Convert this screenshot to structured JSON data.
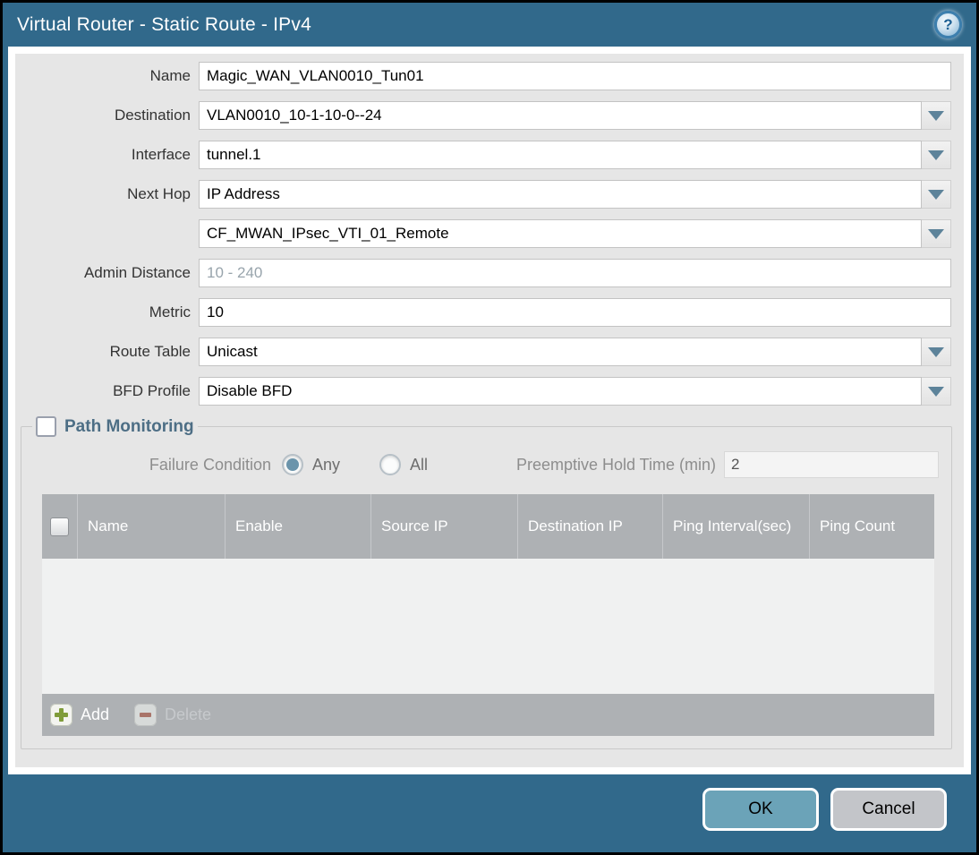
{
  "dialog": {
    "title": "Virtual Router - Static Route - IPv4",
    "help_glyph": "?"
  },
  "form": {
    "name": {
      "label": "Name",
      "value": "Magic_WAN_VLAN0010_Tun01"
    },
    "destination": {
      "label": "Destination",
      "value": "VLAN0010_10-1-10-0--24"
    },
    "interface": {
      "label": "Interface",
      "value": "tunnel.1"
    },
    "next_hop": {
      "label": "Next Hop",
      "value": "IP Address"
    },
    "next_hop_address": {
      "value": "CF_MWAN_IPsec_VTI_01_Remote"
    },
    "admin_distance": {
      "label": "Admin Distance",
      "placeholder": "10 - 240",
      "value": ""
    },
    "metric": {
      "label": "Metric",
      "value": "10"
    },
    "route_table": {
      "label": "Route Table",
      "value": "Unicast"
    },
    "bfd_profile": {
      "label": "BFD Profile",
      "value": "Disable BFD"
    }
  },
  "path_monitoring": {
    "title": "Path Monitoring",
    "enabled": false,
    "failure_condition_label": "Failure Condition",
    "options": [
      {
        "label": "Any",
        "selected": true
      },
      {
        "label": "All",
        "selected": false
      }
    ],
    "preemptive_hold_time_label": "Preemptive Hold Time (min)",
    "preemptive_hold_time_value": "2",
    "table": {
      "columns": [
        "Name",
        "Enable",
        "Source IP",
        "Destination IP",
        "Ping Interval(sec)",
        "Ping Count"
      ],
      "rows": [],
      "add_label": "Add",
      "delete_label": "Delete"
    }
  },
  "footer": {
    "ok_label": "OK",
    "cancel_label": "Cancel"
  },
  "colors": {
    "titlebar": "#31698b",
    "ok_button": "#6ba3b8",
    "cancel_button": "#c3c5c9",
    "table_header": "#aeb1b4",
    "pm_title": "#4d6e85",
    "add_icon_green": "#7f9c3a",
    "delete_icon_red": "#a96a5c",
    "dropdown_arrow": "#5d839a"
  }
}
